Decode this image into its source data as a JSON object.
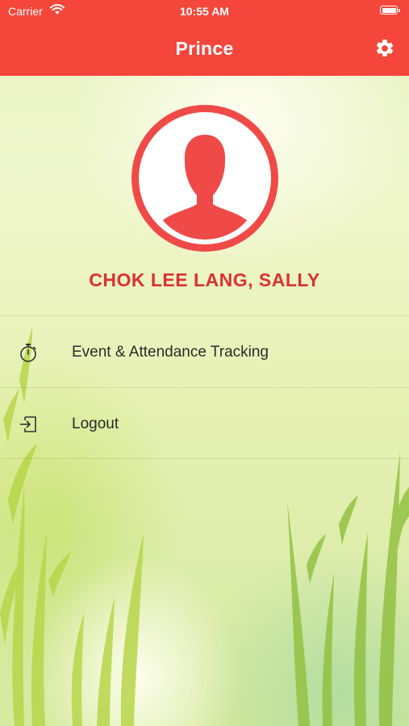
{
  "status_bar": {
    "carrier": "Carrier",
    "time": "10:55 AM",
    "wifi_icon": "wifi-icon",
    "battery_icon": "battery-icon"
  },
  "header": {
    "title": "Prince",
    "settings_icon": "gear-icon"
  },
  "profile": {
    "avatar_icon": "user-silhouette-icon",
    "name": "CHOK LEE LANG, SALLY"
  },
  "menu": {
    "items": [
      {
        "label": "Event & Attendance Tracking",
        "icon": "stopwatch-icon"
      },
      {
        "label": "Logout",
        "icon": "logout-icon"
      }
    ]
  },
  "colors": {
    "accent": "#f4463a",
    "name_text": "#d93136",
    "avatar_fill": "#ef4a47"
  }
}
